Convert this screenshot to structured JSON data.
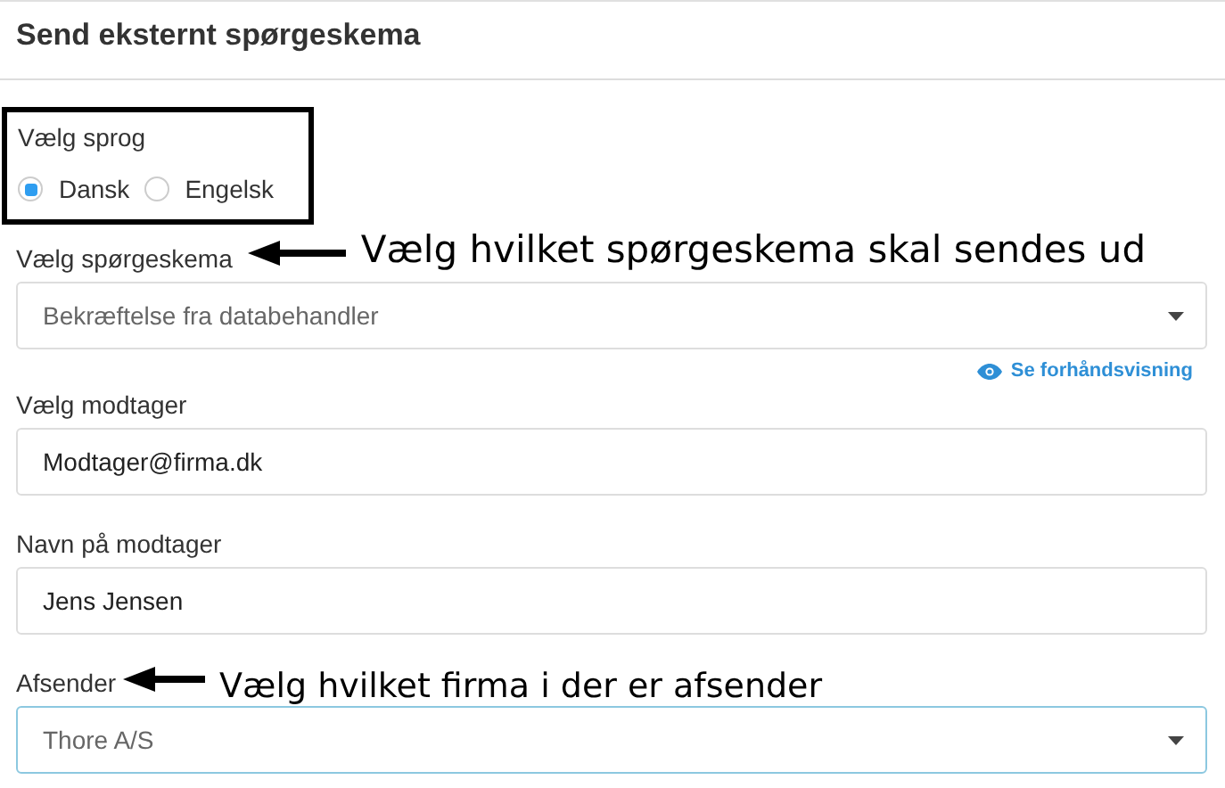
{
  "header": {
    "title": "Send eksternt spørgeskema"
  },
  "language": {
    "label": "Vælg sprog",
    "options": [
      {
        "label": "Dansk",
        "selected": true
      },
      {
        "label": "Engelsk",
        "selected": false
      }
    ]
  },
  "fields": [
    {
      "kind": "select",
      "label": "Vælg spørgeskema",
      "value": "Bekræftelse fra databehandler",
      "focused": false,
      "annotation": "Vælg hvilket spørgeskema skal sendes ud",
      "link": "Se forhåndsvisning"
    },
    {
      "kind": "input",
      "label": "Vælg modtager",
      "value": "Modtager@firma.dk",
      "focused": false
    },
    {
      "kind": "input",
      "label": "Navn på modtager",
      "value": "Jens Jensen",
      "focused": false
    },
    {
      "kind": "select",
      "label": "Afsender",
      "value": "Thore A/S",
      "focused": true,
      "annotation": "Vælg hvilket firma i der er afsender"
    }
  ]
}
